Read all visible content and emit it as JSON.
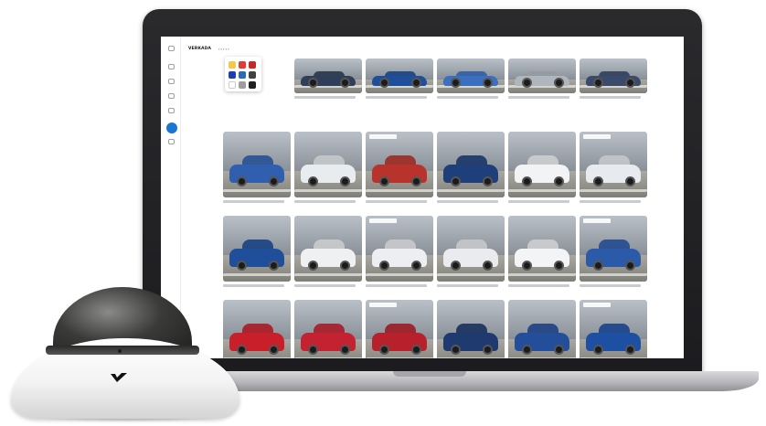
{
  "app": {
    "brand": "ᴠᴇʀᴋᴀᴅᴀ",
    "tabs_text": "▪ ▪ ▪ ▪ ▪"
  },
  "sidebar": {
    "items": [
      {
        "icon": "home-icon",
        "active": false
      },
      {
        "icon": "dashboard-icon",
        "active": false
      },
      {
        "icon": "video-icon",
        "active": false
      },
      {
        "icon": "people-icon",
        "active": false
      },
      {
        "icon": "person-icon",
        "active": false
      },
      {
        "icon": "vehicle-search-icon",
        "active": true
      },
      {
        "icon": "settings-icon",
        "active": false
      }
    ]
  },
  "color_filter": {
    "swatches": [
      "#f2c94c",
      "#e53935",
      "#c62828",
      "#1e40af",
      "#2b6cb0",
      "#424242",
      "#ffffff",
      "#9e9e9e",
      "#212121"
    ]
  },
  "vehicle_results": [
    {
      "color": "#2f3f5a",
      "row": 0
    },
    {
      "color": "#1f4f9a",
      "row": 0
    },
    {
      "color": "#3b6fbf",
      "row": 0
    },
    {
      "color": "#b0b6bd",
      "row": 0
    },
    {
      "color": "#3a4a6a",
      "row": 0
    },
    {
      "color": "#2f5fae",
      "row": 1
    },
    {
      "color": "#e9ecef",
      "row": 1
    },
    {
      "color": "#b8332b",
      "row": 1
    },
    {
      "color": "#1f3f7a",
      "row": 1
    },
    {
      "color": "#f1f3f5",
      "row": 1
    },
    {
      "color": "#e7eaee",
      "row": 1
    },
    {
      "color": "#1f4f9a",
      "row": 2
    },
    {
      "color": "#eef0f2",
      "row": 2
    },
    {
      "color": "#eceef1",
      "row": 2
    },
    {
      "color": "#e9ebee",
      "row": 2
    },
    {
      "color": "#f3f4f6",
      "row": 2
    },
    {
      "color": "#2a5aa8",
      "row": 2
    },
    {
      "color": "#c81f2a",
      "row": 3
    },
    {
      "color": "#c42230",
      "row": 3
    },
    {
      "color": "#b8202c",
      "row": 3
    },
    {
      "color": "#1e3a6e",
      "row": 3
    },
    {
      "color": "#234e9a",
      "row": 3
    },
    {
      "color": "#1d4fa3",
      "row": 3
    }
  ]
}
